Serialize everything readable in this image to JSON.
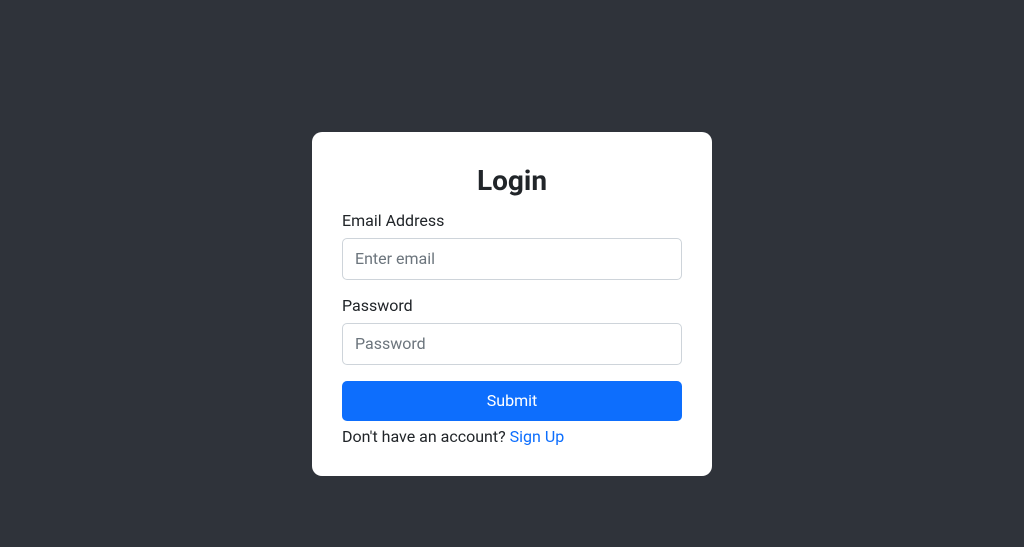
{
  "login": {
    "title": "Login",
    "email": {
      "label": "Email Address",
      "placeholder": "Enter email"
    },
    "password": {
      "label": "Password",
      "placeholder": "Password"
    },
    "submit_label": "Submit",
    "signup_prompt": "Don't have an account? ",
    "signup_link_label": "Sign Up"
  }
}
